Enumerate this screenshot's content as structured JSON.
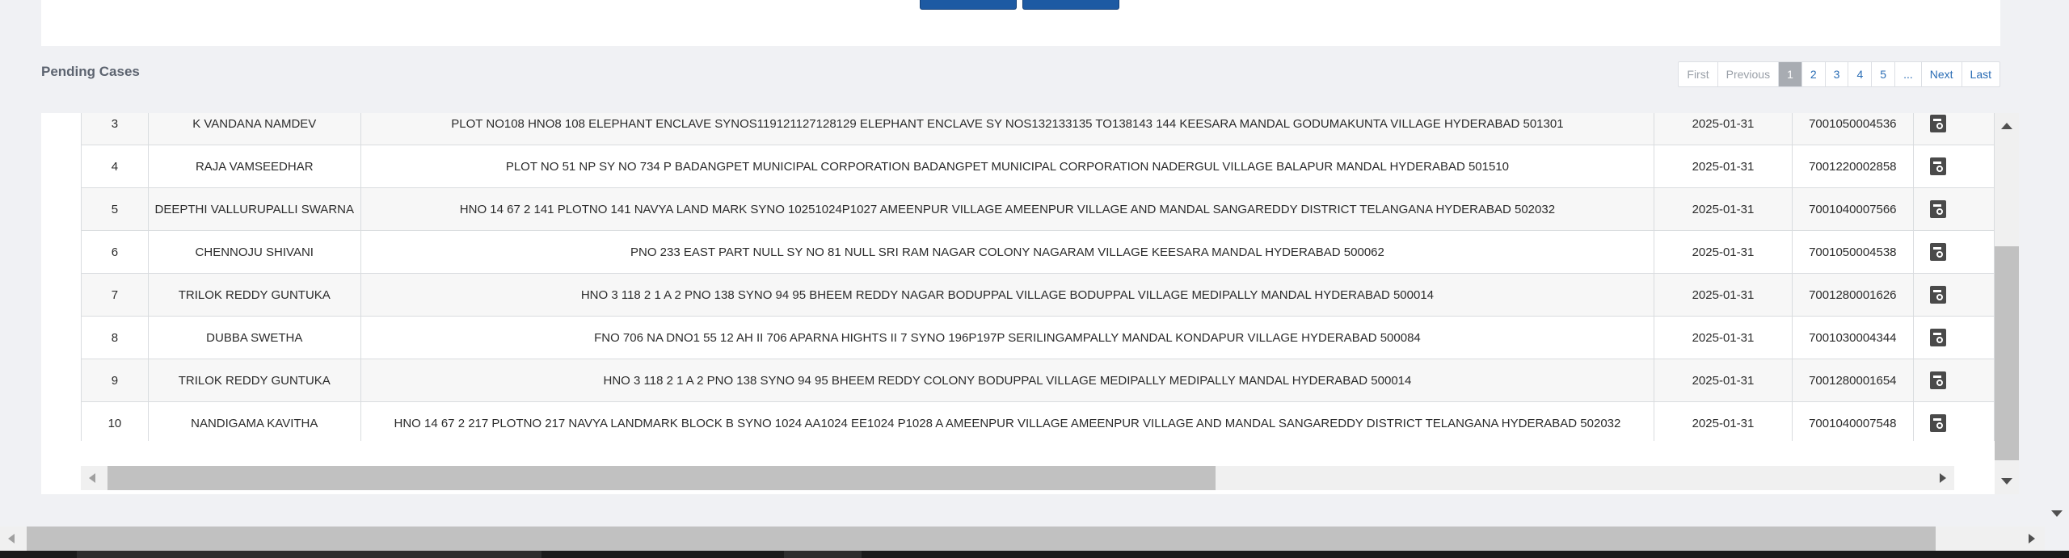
{
  "section": {
    "title": "Pending Cases"
  },
  "pagination": {
    "first": "First",
    "previous": "Previous",
    "pages": [
      "1",
      "2",
      "3",
      "4",
      "5"
    ],
    "current_page": "1",
    "ellipsis": "...",
    "next": "Next",
    "last": "Last"
  },
  "rows": [
    {
      "sno": "3",
      "name": "K VANDANA NAMDEV",
      "address": "PLOT NO108 HNO8 108 ELEPHANT ENCLAVE SYNOS119121127128129 ELEPHANT ENCLAVE SY NOS132133135 TO138143 144 KEESARA MANDAL GODUMAKUNTA VILLAGE HYDERABAD 501301",
      "date": "2025-01-31",
      "app_no": "7001050004536"
    },
    {
      "sno": "4",
      "name": "RAJA VAMSEEDHAR",
      "address": "PLOT NO 51 NP SY NO 734 P BADANGPET MUNICIPAL CORPORATION BADANGPET MUNICIPAL CORPORATION NADERGUL VILLAGE BALAPUR MANDAL HYDERABAD 501510",
      "date": "2025-01-31",
      "app_no": "7001220002858"
    },
    {
      "sno": "5",
      "name": "DEEPTHI VALLURUPALLI SWARNA",
      "address": "HNO 14 67 2 141 PLOTNO 141 NAVYA LAND MARK SYNO 10251024P1027 AMEENPUR VILLAGE AMEENPUR VILLAGE AND MANDAL SANGAREDDY DISTRICT TELANGANA HYDERABAD 502032",
      "date": "2025-01-31",
      "app_no": "7001040007566"
    },
    {
      "sno": "6",
      "name": "CHENNOJU SHIVANI",
      "address": "PNO 233 EAST PART NULL SY NO 81 NULL SRI RAM NAGAR COLONY NAGARAM VILLAGE KEESARA MANDAL HYDERABAD 500062",
      "date": "2025-01-31",
      "app_no": "7001050004538"
    },
    {
      "sno": "7",
      "name": "TRILOK REDDY GUNTUKA",
      "address": "HNO 3 118 2 1 A 2 PNO 138 SYNO 94 95 BHEEM REDDY NAGAR BODUPPAL VILLAGE BODUPPAL VILLAGE MEDIPALLY MANDAL HYDERABAD 500014",
      "date": "2025-01-31",
      "app_no": "7001280001626"
    },
    {
      "sno": "8",
      "name": "DUBBA SWETHA",
      "address": "FNO 706 NA DNO1 55 12 AH II 706 APARNA HIGHTS II 7 SYNO 196P197P SERILINGAMPALLY MANDAL KONDAPUR VILLAGE HYDERABAD 500084",
      "date": "2025-01-31",
      "app_no": "7001030004344"
    },
    {
      "sno": "9",
      "name": "TRILOK REDDY GUNTUKA",
      "address": "HNO 3 118 2 1 A 2 PNO 138 SYNO 94 95 BHEEM REDDY COLONY BODUPPAL VILLAGE MEDIPALLY MEDIPALLY MANDAL HYDERABAD 500014",
      "date": "2025-01-31",
      "app_no": "7001280001654"
    },
    {
      "sno": "10",
      "name": "NANDIGAMA KAVITHA",
      "address": "HNO 14 67 2 217 PLOTNO 217 NAVYA LANDMARK BLOCK B SYNO 1024 AA1024 EE1024 P1028 A AMEENPUR VILLAGE AMEENPUR VILLAGE AND MANDAL SANGAREDDY DISTRICT TELANGANA HYDERABAD 502032",
      "date": "2025-01-31",
      "app_no": "7001040007548"
    }
  ],
  "row_action_icon": "view-document-icon",
  "colors": {
    "page_bg": "#f0f1f4",
    "primary_button": "#1d5aa3",
    "pager_active": "#a8acb2",
    "link": "#2a6db5",
    "row_stripe": "#f7f7f7"
  }
}
